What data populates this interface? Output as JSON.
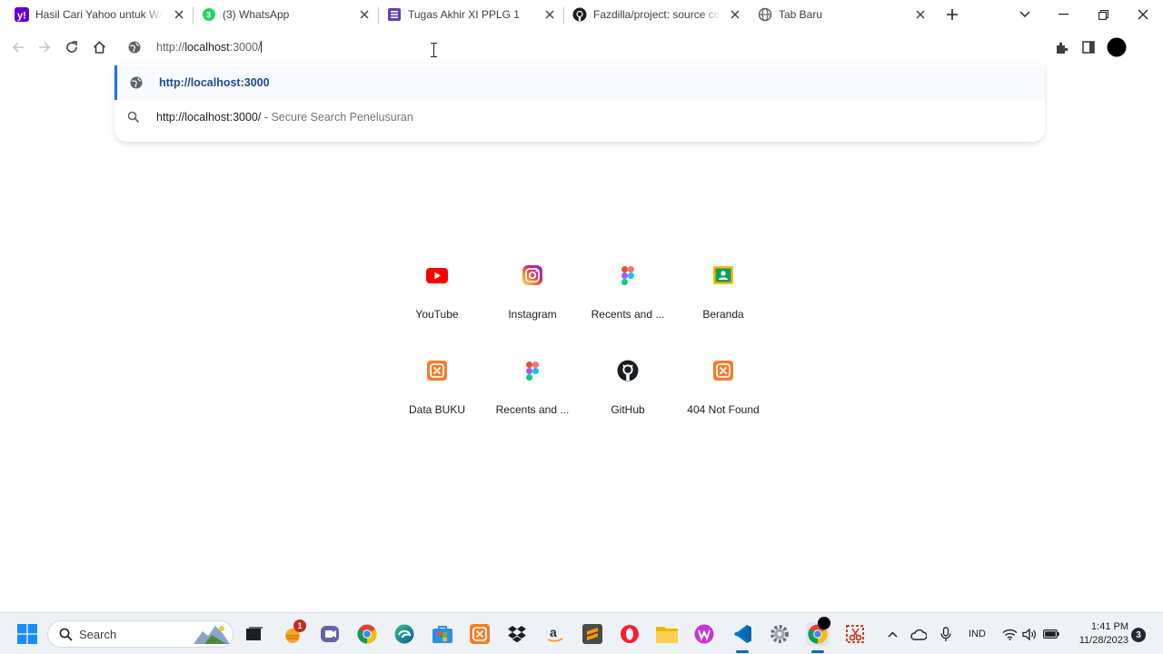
{
  "tabs": [
    {
      "title": "Hasil Cari Yahoo untuk WA W",
      "favicon": "yahoo-icon"
    },
    {
      "title": "(3) WhatsApp",
      "favicon": "whatsapp-icon"
    },
    {
      "title": "Tugas Akhir XI PPLG 1",
      "favicon": "forms-icon"
    },
    {
      "title": "Fazdilla/project: source code",
      "favicon": "github-icon"
    },
    {
      "title": "Tab Baru",
      "favicon": "globe-icon"
    }
  ],
  "address_bar": {
    "prefix": "http://",
    "host": "localhost",
    "suffix": ":3000/"
  },
  "omnibox": {
    "suggestions": [
      {
        "text": "http://localhost:3000",
        "icon": "globe-icon"
      },
      {
        "text": "http://localhost:3000/",
        "sub": " - Secure Search Penelusuran",
        "icon": "search-icon"
      }
    ]
  },
  "shortcuts": [
    {
      "label": "YouTube",
      "icon": "youtube-icon"
    },
    {
      "label": "Instagram",
      "icon": "instagram-icon"
    },
    {
      "label": "Recents and ...",
      "icon": "figma-icon"
    },
    {
      "label": "Beranda",
      "icon": "classroom-icon"
    },
    {
      "label": "Data BUKU",
      "icon": "xampp-icon"
    },
    {
      "label": "Recents and ...",
      "icon": "figma-icon"
    },
    {
      "label": "GitHub",
      "icon": "github-icon"
    },
    {
      "label": "404 Not Found",
      "icon": "xampp-icon"
    }
  ],
  "taskbar": {
    "search_placeholder": "Search",
    "pinned": [
      "file-explorer-icon",
      "widgets-icon",
      "teams-icon",
      "chrome-icon",
      "edge-icon",
      "store-icon",
      "xampp-icon",
      "dropbox-icon",
      "amazon-icon",
      "sublime-icon",
      "opera-icon",
      "folder-icon",
      "wps-icon",
      "vscode-icon",
      "settings-icon",
      "chrome-icon",
      "snipping-tool-icon"
    ],
    "widgets_badge": "1",
    "language": "IND",
    "time": "1:41 PM",
    "date": "11/28/2023",
    "notification_count": "3"
  },
  "colors": {
    "accent": "#1a73e8",
    "youtube": "#ff0000",
    "xampp": "#fb7a24"
  }
}
